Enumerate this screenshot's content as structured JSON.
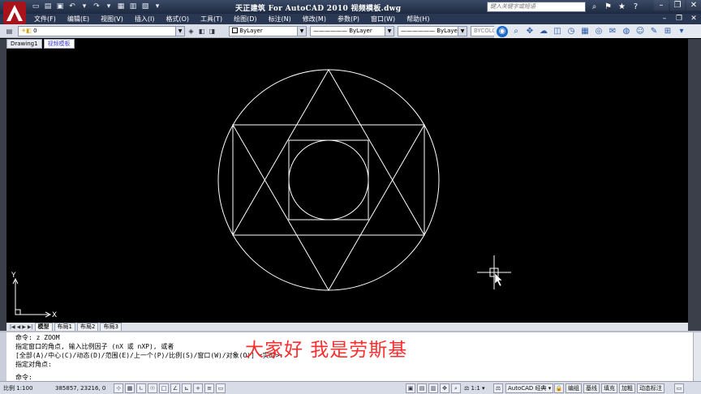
{
  "window": {
    "title": "天正建筑 For AutoCAD 2010  视频模板.dwg",
    "search_placeholder": "键入关键字或短语"
  },
  "menu": [
    "文件(F)",
    "编辑(E)",
    "视图(V)",
    "插入(I)",
    "格式(O)",
    "工具(T)",
    "绘图(D)",
    "标注(N)",
    "修改(M)",
    "参数(P)",
    "窗口(W)",
    "帮助(H)"
  ],
  "toolbar": {
    "layer_value": "0",
    "color_value": "ByLayer",
    "linetype_value": "ByLayer",
    "lineweight_value": "ByLayer",
    "plotstyle_value": "BYCOLOR"
  },
  "doc_tabs": [
    "Drawing1",
    "视频模板"
  ],
  "canvas": {
    "ucs_y": "Y",
    "ucs_x": "X"
  },
  "layout_tabs": [
    "模型",
    "布局1",
    "布局2",
    "布局3"
  ],
  "command": {
    "lines": [
      "命令: z ZOOM",
      "指定窗口的角点, 输入比例因子 (nX 或 nXP), 或者",
      "[全部(A)/中心(C)/动态(D)/范围(E)/上一个(P)/比例(S)/窗口(W)/对象(O)] <实时>:",
      "指定对角点:",
      "命令:"
    ]
  },
  "subtitle": "大家好 我是劳斯基",
  "status": {
    "scale": "比例 1:100",
    "coords": "385857, 23216, 0",
    "anno_scale": "1:1",
    "workspace": "AutoCAD 经典",
    "btn_edit": "编组",
    "btn_baseline": "基线",
    "btn_fill": "填充",
    "btn_bold": "加粗",
    "btn_dynamic": "动态标注"
  },
  "colors": {
    "title_bg": "#1d2940",
    "drawing_lines": "#ffffff",
    "subtitle": "#ff2e2e",
    "canvas_bg": "#000000"
  }
}
